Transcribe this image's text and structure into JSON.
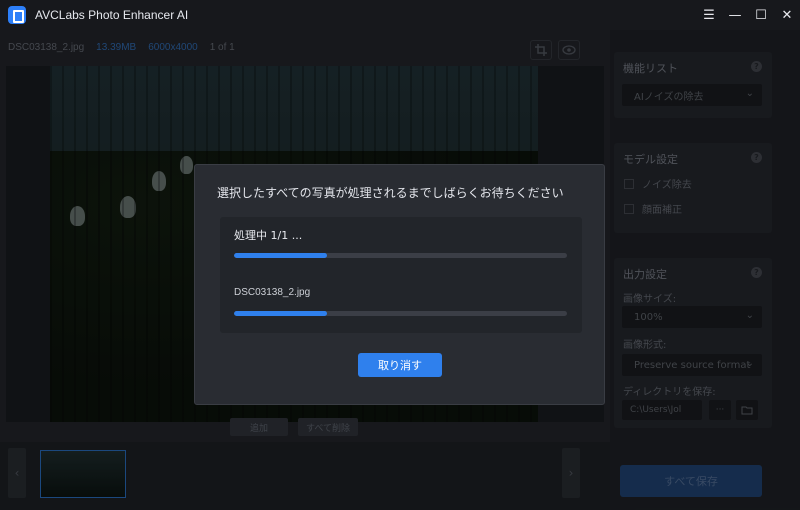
{
  "app": {
    "title": "AVCLabs Photo Enhancer AI"
  },
  "window_controls": {
    "menu": "☰",
    "minimize": "—",
    "maximize": "☐",
    "close": "✕"
  },
  "file_info": {
    "name": "DSC03138_2.jpg",
    "size": "13.39MB",
    "dimensions": "6000x4000",
    "page": "1 of 1"
  },
  "toolbar": {
    "crop_icon": "crop-icon",
    "eye_icon": "eye-icon"
  },
  "actions": {
    "add_label": "追加",
    "delete_all_label": "すべて削除"
  },
  "thumbnails": {
    "prev": "‹",
    "next": "›"
  },
  "panel": {
    "feature_list": {
      "title": "機能リスト",
      "selected": "AIノイズの除去"
    },
    "model_settings": {
      "title": "モデル設定",
      "options": [
        "ノイズ除去",
        "顔面補正"
      ]
    },
    "output_settings": {
      "title": "出力設定",
      "size_label": "画像サイズ:",
      "size_value": "100%",
      "format_label": "画像形式:",
      "format_value": "Preserve source format",
      "dir_label": "ディレクトリを保存:",
      "dir_value": "C:\\Users\\Jol",
      "dir_more": "···"
    },
    "save_all_label": "すべて保存"
  },
  "modal": {
    "message": "選択したすべての写真が処理されるまでしばらくお待ちください",
    "progress_title": "処理中 1/1 ...",
    "overall_progress": 0.28,
    "file_name": "DSC03138_2.jpg",
    "file_progress": 0.28,
    "cancel_label": "取り消す"
  },
  "colors": {
    "accent": "#2f80ed",
    "background": "#1b1d22",
    "modal": "#292c32"
  }
}
